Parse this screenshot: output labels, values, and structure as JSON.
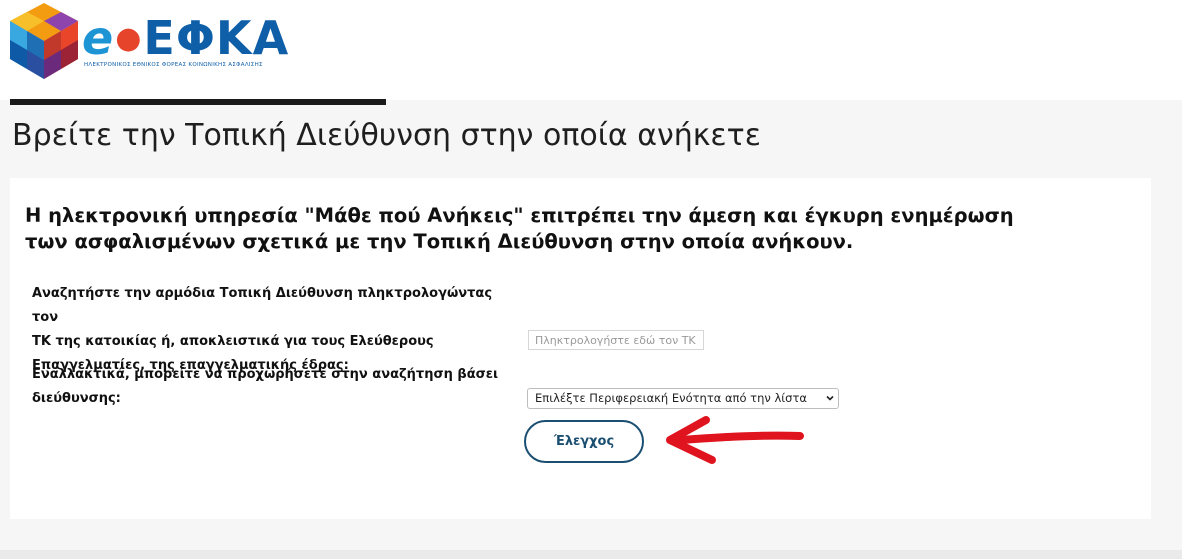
{
  "header": {
    "logo": {
      "text_prefix": "e",
      "text_main": "ΕΦΚΑ",
      "subtitle": "ΗΛΕΚΤΡΟΝΙΚΟΣ ΕΘΝΙΚΟΣ ΦΟΡΕΑΣ ΚΟΙΝΩΝΙΚΗΣ ΑΣΦΑΛΙΣΗΣ"
    }
  },
  "page": {
    "title": "Βρείτε την Τοπική Διεύθυνση στην οποία ανήκετε"
  },
  "card": {
    "intro": "Η ηλεκτρονική υπηρεσία \"Μάθε πού Ανήκεις\" επιτρέπει την άμεση και έγκυρη ενημέρωση των ασφαλισμένων σχετικά με την Τοπική Διεύθυνση στην οποία ανήκουν.",
    "tk_label_line1": "Αναζητήστε την αρμόδια Τοπική Διεύθυνση πληκτρολογώντας τον",
    "tk_label_line2": "ΤΚ της κατοικίας ή, αποκλειστικά για τους Ελεύθερους",
    "tk_label_line3": "Επαγγελματίες, της επαγγελματικής έδρας:",
    "tk_input": {
      "value": "",
      "placeholder": "Πληκτρολογήστε εδώ τον ΤΚ"
    },
    "address_label_line1": "Εναλλακτικά, μπορείτε να προχωρήσετε στην αναζήτηση βάσει",
    "address_label_line2": "διεύθυνσης:",
    "region_select": {
      "selected": "Επιλέξτε Περιφερειακή Ενότητα από την λίστα",
      "icon": "chevron-down-icon"
    },
    "check_button": "Έλεγχος"
  },
  "annotation": {
    "icon": "red-arrow-icon",
    "color": "#e0141e"
  },
  "colors": {
    "brand_blue": "#0f5fa8",
    "button_border": "#1b4f72",
    "page_background": "#f6f6f6"
  }
}
